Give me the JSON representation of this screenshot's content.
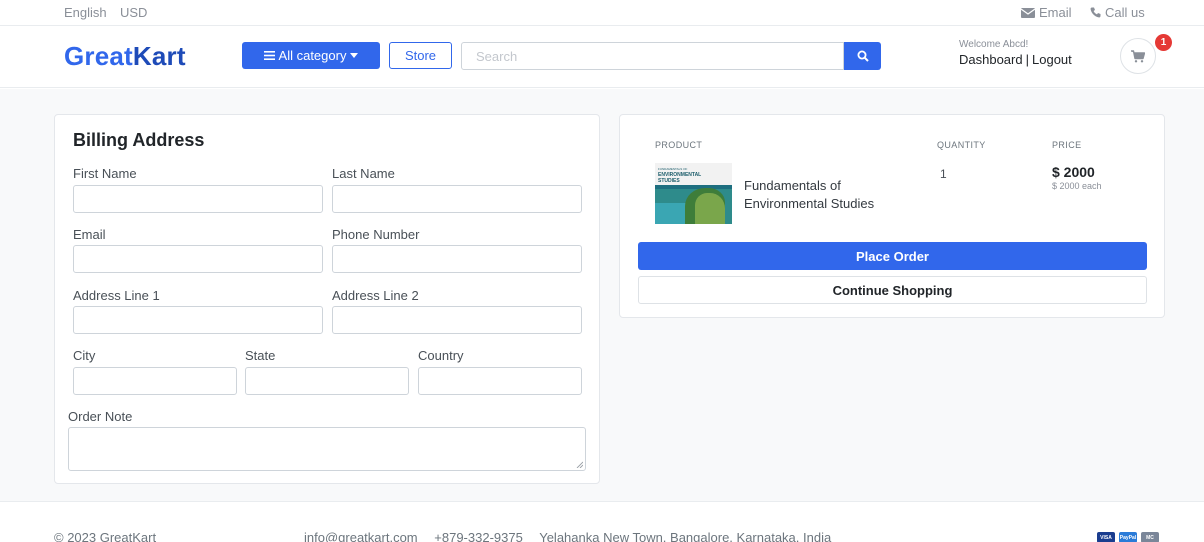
{
  "topbar": {
    "language": "English",
    "currency": "USD",
    "email_label": "Email",
    "call_label": "Call us"
  },
  "header": {
    "logo_great": "Great",
    "logo_kart": "Kart",
    "category_button": "All category",
    "store_button": "Store",
    "search_placeholder": "Search",
    "welcome_text": "Welcome Abcd!",
    "dashboard_link": "Dashboard",
    "logout_link": "Logout",
    "cart_count": "1"
  },
  "billing": {
    "title": "Billing Address",
    "fields": {
      "first_name": "First Name",
      "last_name": "Last Name",
      "email": "Email",
      "phone": "Phone Number",
      "address1": "Address Line 1",
      "address2": "Address Line 2",
      "city": "City",
      "state": "State",
      "country": "Country",
      "order_note": "Order Note"
    }
  },
  "summary": {
    "columns": {
      "product": "PRODUCT",
      "quantity": "QUANTITY",
      "price": "PRICE"
    },
    "item": {
      "cover_title_1": "FUNDAMENTALS OF",
      "cover_title_2": "ENVIRONMENTAL",
      "cover_title_3": "STUDIES",
      "name": "Fundamentals of Environmental Studies",
      "quantity": "1",
      "price": "$ 2000",
      "each": "$ 2000 each"
    },
    "place_order": "Place Order",
    "continue_shopping": "Continue Shopping"
  },
  "footer": {
    "copyright": "© 2023 GreatKart",
    "email": "info@greatkart.com",
    "phone": "+879-332-9375",
    "address": "Yelahanka New Town, Bangalore, Karnataka, India",
    "payment_cards": [
      {
        "name": "VISA",
        "color": "#1a3d8f"
      },
      {
        "name": "PayPal",
        "color": "#2a7bd8"
      },
      {
        "name": "MC",
        "color": "#7a8699"
      }
    ]
  },
  "colors": {
    "accent": "#3167eb",
    "badge": "#e53935"
  }
}
